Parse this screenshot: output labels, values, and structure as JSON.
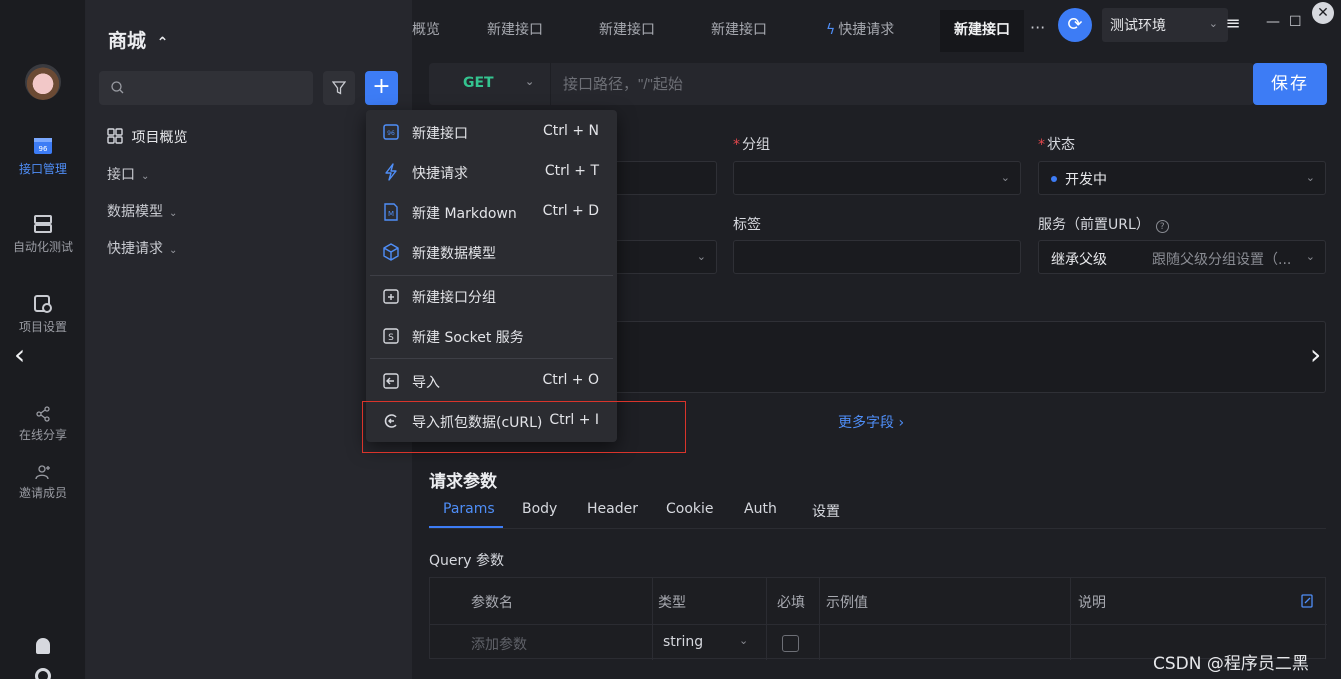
{
  "rail": {
    "items": [
      {
        "label": "接口管理",
        "icon": "api-icon",
        "active": true
      },
      {
        "label": "自动化测试",
        "icon": "server-icon",
        "active": false
      },
      {
        "label": "项目设置",
        "icon": "settings-icon",
        "active": false
      },
      {
        "label": "在线分享",
        "icon": "share-icon",
        "active": false
      },
      {
        "label": "邀请成员",
        "icon": "user-add-icon",
        "active": false
      }
    ]
  },
  "project": {
    "title": "商城",
    "switch_icon": "⌃"
  },
  "tree": {
    "search_placeholder": "",
    "add_label": "+",
    "overview": "项目概览",
    "items": [
      {
        "label": "接口"
      },
      {
        "label": "数据模型"
      },
      {
        "label": "快捷请求"
      }
    ]
  },
  "tabs": [
    {
      "label": "概览",
      "active": false
    },
    {
      "label": "新建接口",
      "active": false
    },
    {
      "label": "新建接口",
      "active": false
    },
    {
      "label": "新建接口",
      "active": false
    },
    {
      "label": "快捷请求",
      "active": false,
      "icon": "bolt-icon"
    },
    {
      "label": "新建接口",
      "active": true
    }
  ],
  "tabbar": {
    "more": "···",
    "env_name": "测试环境",
    "minimize": "—",
    "maximize": "☐",
    "close": "✕"
  },
  "request": {
    "method": "GET",
    "url_placeholder": "接口路径，\"/\"起始",
    "save_label": "保存"
  },
  "form": {
    "group_label": "分组",
    "group_value": "",
    "status_label": "状态",
    "status_value": "开发中",
    "tags_label": "标签",
    "service_label": "服务（前置URL）",
    "service_value": "继承父级",
    "service_hint": "跟随父级分组设置（...",
    "more_fields": "更多字段 ›"
  },
  "params": {
    "section_title": "请求参数",
    "tabs": [
      "Params",
      "Body",
      "Header",
      "Cookie",
      "Auth",
      "设置"
    ],
    "active_tab": "Params",
    "query_label": "Query 参数",
    "columns": [
      "参数名",
      "类型",
      "必填",
      "示例值",
      "说明"
    ],
    "row": {
      "name_placeholder": "添加参数",
      "type": "string"
    }
  },
  "menu": {
    "items": [
      {
        "label": "新建接口",
        "shortcut": "Ctrl + N",
        "icon": "api-file-icon"
      },
      {
        "label": "快捷请求",
        "shortcut": "Ctrl + T",
        "icon": "bolt-icon"
      },
      {
        "label": "新建 Markdown",
        "shortcut": "Ctrl + D",
        "icon": "markdown-icon"
      },
      {
        "label": "新建数据模型",
        "shortcut": "",
        "icon": "cube-icon"
      },
      {
        "label": "新建接口分组",
        "shortcut": "",
        "icon": "folder-add-icon"
      },
      {
        "label": "新建 Socket 服务",
        "shortcut": "",
        "icon": "socket-icon"
      },
      {
        "label": "导入",
        "shortcut": "Ctrl + O",
        "icon": "import-icon"
      },
      {
        "label": "导入抓包数据(cURL)",
        "shortcut": "Ctrl + I",
        "icon": "curl-icon"
      }
    ]
  },
  "watermark": "CSDN @程序员二黑",
  "colors": {
    "accent": "#3d7cf5",
    "get_method": "#34c38f",
    "required": "#e5484d",
    "highlight": "#d9342b"
  }
}
